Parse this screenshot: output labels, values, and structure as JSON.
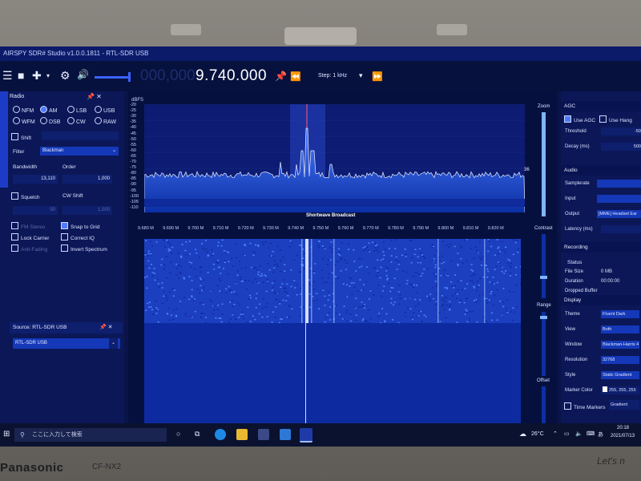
{
  "titlebar": {
    "title": "AIRSPY SDR# Studio v1.0.0.1811 - RTL-SDR USB"
  },
  "toolbar": {
    "frequency": "9.740.000",
    "ghost_digits": "000,000",
    "step": "Step: 1 kHz",
    "icons": [
      "hamburger-icon",
      "stop-icon",
      "add-icon",
      "chevron-down-icon",
      "gear-icon",
      "volume-icon",
      "pin-icon",
      "rewind-icon",
      "fast-forward-icon"
    ]
  },
  "radio_panel": {
    "header": "Radio",
    "modes": [
      {
        "label": "NFM",
        "selected": false
      },
      {
        "label": "AM",
        "selected": true
      },
      {
        "label": "LSB",
        "selected": false
      },
      {
        "label": "USB",
        "selected": false
      },
      {
        "label": "WFM",
        "selected": false
      },
      {
        "label": "DSB",
        "selected": false
      },
      {
        "label": "CW",
        "selected": false
      },
      {
        "label": "RAW",
        "selected": false
      }
    ],
    "shift_label": "Shift",
    "filter_label": "Filter",
    "filter_value": "Blackman",
    "bandwidth_label": "Bandwidth",
    "bandwidth_value": "13,110",
    "order_label": "Order",
    "order_value": "1,000",
    "squelch_label": "Squelch",
    "cw_shift_label": "CW Shift",
    "squelch_value": "50",
    "cw_shift_value": "1,000",
    "checks": [
      {
        "label": "FM Stereo",
        "checked": false,
        "dim": true
      },
      {
        "label": "Snap to Grid",
        "checked": true,
        "dim": false
      },
      {
        "label": "Lock Carrier",
        "checked": false,
        "dim": false
      },
      {
        "label": "Correct IQ",
        "checked": false,
        "dim": false
      },
      {
        "label": "Anti-Fading",
        "checked": false,
        "dim": true
      },
      {
        "label": "Invert Spectrum",
        "checked": false,
        "dim": false
      }
    ]
  },
  "source_panel": {
    "header": "Source: RTL-SDR USB",
    "value": "RTL-SDR USB"
  },
  "spectrum": {
    "unit": "dBFS",
    "y_ticks": [
      "-20",
      "-25",
      "-30",
      "-35",
      "-40",
      "-45",
      "-50",
      "-55",
      "-60",
      "-65",
      "-70",
      "-75",
      "-80",
      "-85",
      "-90",
      "-95",
      "-100",
      "-105",
      "-110"
    ],
    "x_ticks": [
      "9.680 M",
      "9.690 M",
      "9.700 M",
      "9.710 M",
      "9.720 M",
      "9.730 M",
      "9.740 M",
      "9.750 M",
      "9.760 M",
      "9.770 M",
      "9.780 M",
      "9.790 M",
      "9.800 M",
      "9.810 M",
      "9.820 M"
    ],
    "band_label": "Shortwave Broadcast",
    "center_label": "36"
  },
  "side_controls": {
    "zoom": "Zoom",
    "contrast": "Contrast",
    "range": "Range",
    "offset": "Offset"
  },
  "agc": {
    "header": "AGC",
    "use_agc": "Use AGC",
    "use_hang": "Use Hang",
    "threshold_label": "Threshold",
    "threshold_value": "-50",
    "decay_label": "Decay (ms)",
    "decay_value": "500"
  },
  "audio": {
    "header": "Audio",
    "samplerate_label": "Samplerate",
    "input_label": "Input",
    "output_label": "Output",
    "output_value": "[MME] Headset Ear",
    "latency_label": "Latency (ms)"
  },
  "recording": {
    "header": "Recording",
    "status_label": "Status",
    "filesize_label": "File Size",
    "filesize_value": "0 MB",
    "duration_label": "Duration",
    "duration_value": "00:00:00",
    "dropped_label": "Dropped Buffer"
  },
  "display": {
    "header": "Display",
    "theme_label": "Theme",
    "theme_value": "Fluent Dark",
    "view_label": "View",
    "view_value": "Both",
    "window_label": "Window",
    "window_value": "Blackman-Harris 4",
    "resolution_label": "Resolution",
    "resolution_value": "32768",
    "style_label": "Style",
    "style_value": "Static Gradient",
    "marker_label": "Marker Color",
    "marker_value": "255, 255, 255",
    "time_markers": "Time Markers",
    "gradient": "Gradient"
  },
  "taskbar": {
    "search_placeholder": "ここに入力して検索",
    "temperature": "26°C",
    "ime": "あ",
    "time": "20:18",
    "date": "2021/07/13"
  },
  "bezel": {
    "brand": "Panasonic",
    "model": "CF-NX2",
    "tagline": "Let's n"
  },
  "colors": {
    "accent": "#3a63ff",
    "panel": "#0b1757",
    "spectrum_fill": "#1c3fc0"
  }
}
